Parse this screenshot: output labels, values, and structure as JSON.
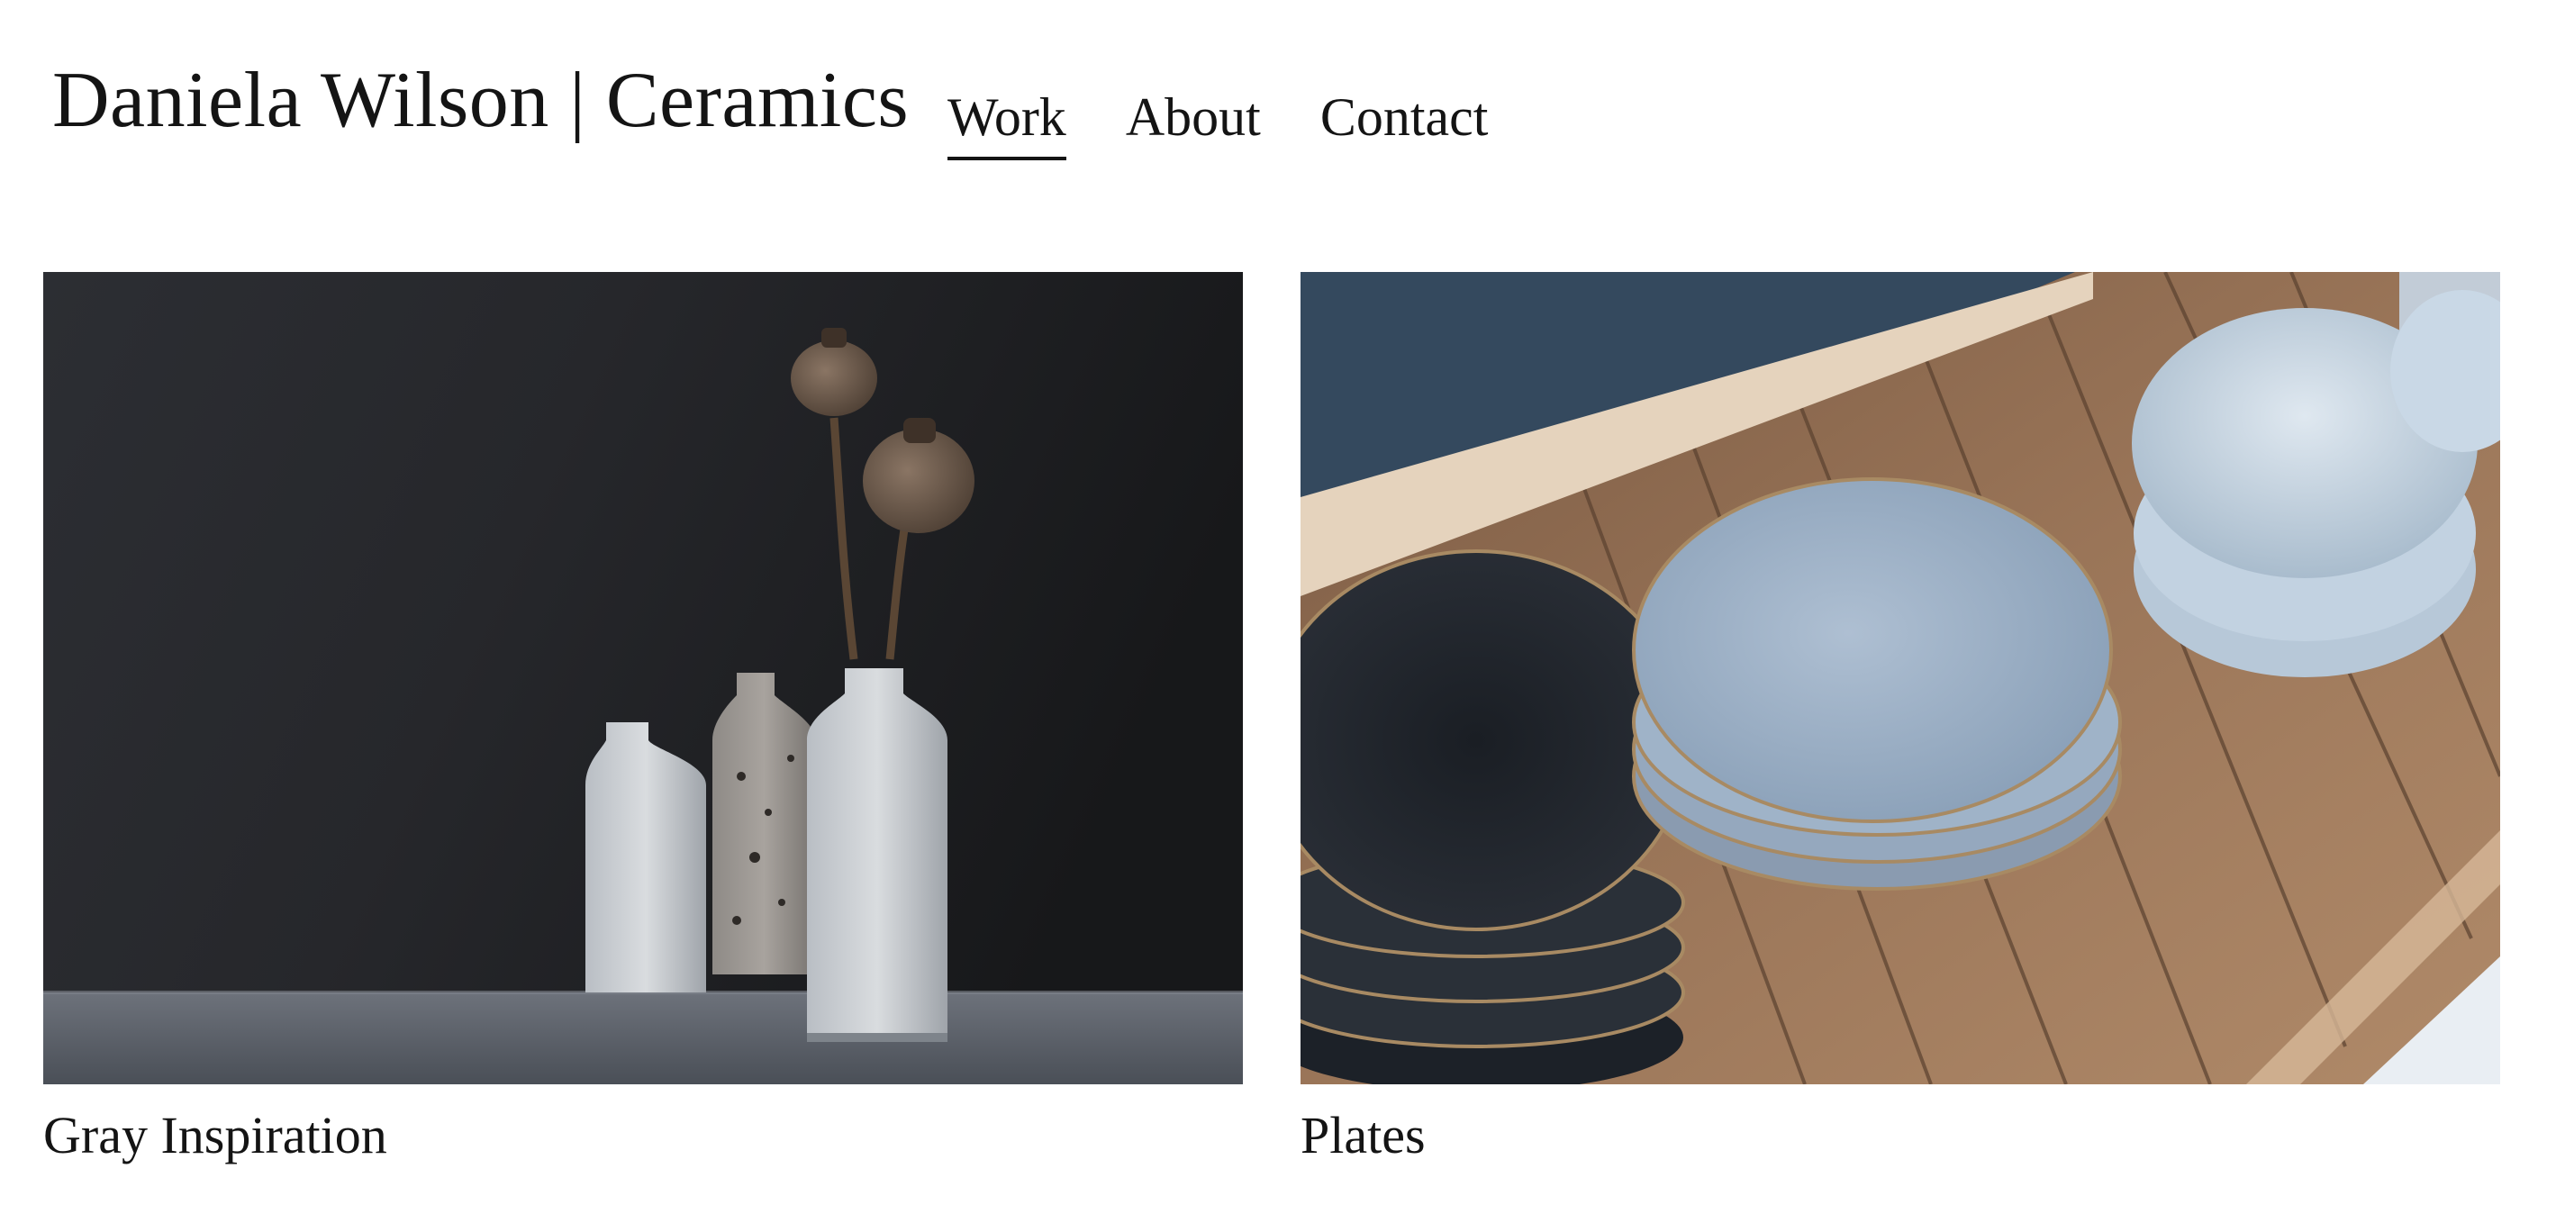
{
  "site": {
    "title": "Daniela Wilson | Ceramics"
  },
  "nav": {
    "items": [
      {
        "label": "Work",
        "active": true
      },
      {
        "label": "About",
        "active": false
      },
      {
        "label": "Contact",
        "active": false
      }
    ]
  },
  "gallery": {
    "items": [
      {
        "caption": "Gray Inspiration",
        "image": "vases-dried-poppies-photo"
      },
      {
        "caption": "Plates",
        "image": "plates-bowls-shelf-photo"
      }
    ]
  },
  "colors": {
    "text": "#141414",
    "background": "#ffffff"
  }
}
